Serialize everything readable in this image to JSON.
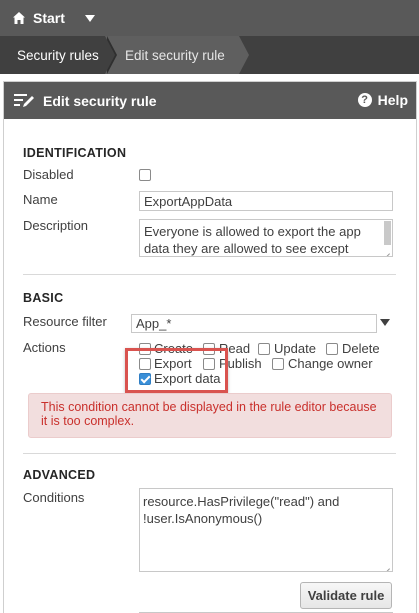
{
  "topbar": {
    "start_label": "Start"
  },
  "breadcrumb": {
    "items": [
      "Security rules",
      "Edit security rule"
    ]
  },
  "panel": {
    "title": "Edit security rule",
    "help_label": "Help"
  },
  "identification": {
    "section_title": "IDENTIFICATION",
    "disabled_label": "Disabled",
    "disabled_checked": false,
    "name_label": "Name",
    "name_value": "ExportAppData",
    "description_label": "Description",
    "description_value": "Everyone is allowed to export the app data they are allowed to see except"
  },
  "basic": {
    "section_title": "BASIC",
    "resource_filter_label": "Resource filter",
    "resource_filter_value": "App_*",
    "actions_label": "Actions",
    "actions": [
      {
        "label": "Create",
        "checked": false
      },
      {
        "label": "Read",
        "checked": false
      },
      {
        "label": "Update",
        "checked": false
      },
      {
        "label": "Delete",
        "checked": false
      },
      {
        "label": "Export",
        "checked": false
      },
      {
        "label": "Publish",
        "checked": false
      },
      {
        "label": "Change owner",
        "checked": false
      },
      {
        "label": "Export data",
        "checked": true
      }
    ],
    "alert_text": "This condition cannot be displayed in the rule editor because it is too complex."
  },
  "advanced": {
    "section_title": "ADVANCED",
    "conditions_label": "Conditions",
    "conditions_value": "resource.HasPrivilege(\"read\") and !user.IsAnonymous()",
    "validate_label": "Validate rule"
  },
  "colors": {
    "highlight": "#d9534f",
    "checkbox_checked": "#3a8fd8",
    "alert_bg": "#f2dede",
    "alert_text": "#c9302c"
  }
}
